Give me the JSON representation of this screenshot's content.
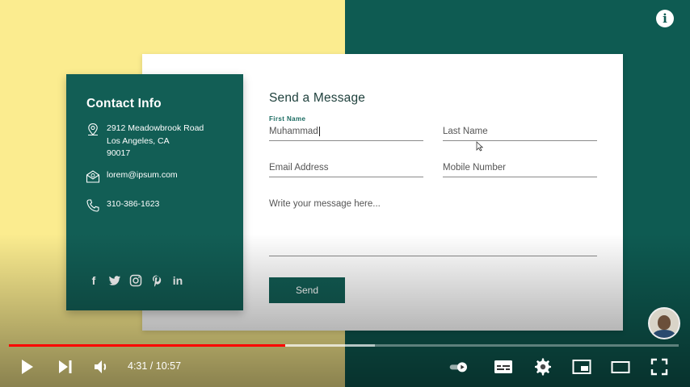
{
  "colors": {
    "yellow_bg": "#fbec8f",
    "teal_bg": "#0e5b52",
    "card_teal": "#125e55",
    "progress_red": "#ff0000"
  },
  "contact": {
    "title": "Contact Info",
    "address": "2912 Meadowbrook Road\nLos Angeles, CA\n90017",
    "email": "lorem@ipsum.com",
    "phone": "310-386-1623",
    "social_icons": [
      "facebook-icon",
      "twitter-icon",
      "instagram-icon",
      "pinterest-icon",
      "linkedin-icon"
    ]
  },
  "form": {
    "title": "Send a Message",
    "first_name_label": "First Name",
    "first_name_value": "Muhammad",
    "last_name_placeholder": "Last Name",
    "email_placeholder": "Email Address",
    "mobile_placeholder": "Mobile Number",
    "message_placeholder": "Write your message here...",
    "send_label": "Send"
  },
  "player": {
    "current_time": "4:31",
    "duration": "10:57",
    "time_display": "4:31 / 10:57",
    "played_fraction": 0.412,
    "buffered_fraction": 0.547,
    "info_icon": "info-icon"
  }
}
